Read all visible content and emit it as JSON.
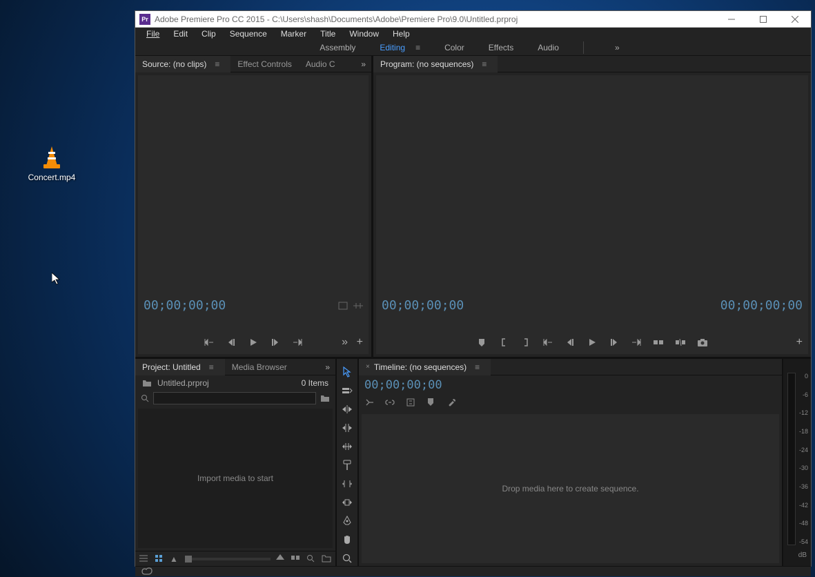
{
  "desktop": {
    "file_label": "Concert.mp4"
  },
  "titlebar": {
    "icon_text": "Pr",
    "title": "Adobe Premiere Pro CC 2015 - C:\\Users\\shash\\Documents\\Adobe\\Premiere Pro\\9.0\\Untitled.prproj"
  },
  "menu": {
    "items": [
      "File",
      "Edit",
      "Clip",
      "Sequence",
      "Marker",
      "Title",
      "Window",
      "Help"
    ]
  },
  "workspace": {
    "items": [
      "Assembly",
      "Editing",
      "Color",
      "Effects",
      "Audio"
    ],
    "active": "Editing"
  },
  "source": {
    "tab_label": "Source: (no clips)",
    "tab_effect_controls": "Effect Controls",
    "tab_audio": "Audio C",
    "timecode": "00;00;00;00"
  },
  "program": {
    "tab_label": "Program: (no sequences)",
    "timecode_left": "00;00;00;00",
    "timecode_right": "00;00;00;00"
  },
  "project": {
    "tab_label": "Project: Untitled",
    "tab_media_browser": "Media Browser",
    "project_file": "Untitled.prproj",
    "items_count": "0 Items",
    "import_hint": "Import media to start"
  },
  "timeline": {
    "tab_label": "Timeline: (no sequences)",
    "timecode": "00;00;00;00",
    "drop_hint": "Drop media here to create sequence."
  },
  "audio_meter": {
    "scale": [
      "0",
      "-6",
      "-12",
      "-18",
      "-24",
      "-30",
      "-36",
      "-42",
      "-48",
      "-54"
    ],
    "unit": "dB"
  }
}
